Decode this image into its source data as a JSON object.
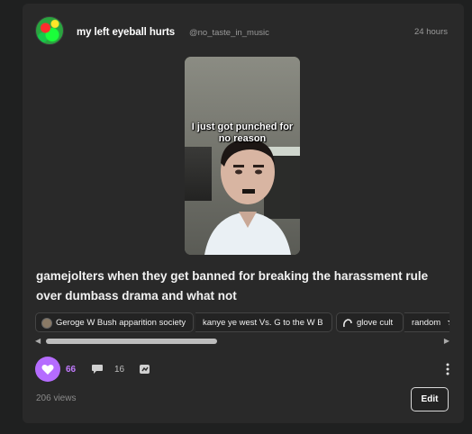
{
  "post": {
    "username": "my left eyeball hurts",
    "handle": "@no_taste_in_music",
    "timestamp": "24 hours",
    "media_caption": "I just got punched for no reason",
    "body": "gamejolters when they get banned for breaking the harassment rule over dumbass drama and what not",
    "tags": [
      {
        "icon": "bush-icon",
        "label": "Geroge W Bush apparition society"
      },
      {
        "icon": "none",
        "label": "kanye ye west Vs. G to the W B"
      },
      {
        "icon": "glove-icon",
        "label": "glove cult"
      },
      {
        "icon": "none",
        "label": "random"
      }
    ],
    "likes": "66",
    "comments": "16",
    "views": "206 views",
    "edit_label": "Edit"
  },
  "colors": {
    "background": "#1f2020",
    "card": "#292929",
    "accent": "#b56cff",
    "muted_text": "#9a9a9a"
  }
}
